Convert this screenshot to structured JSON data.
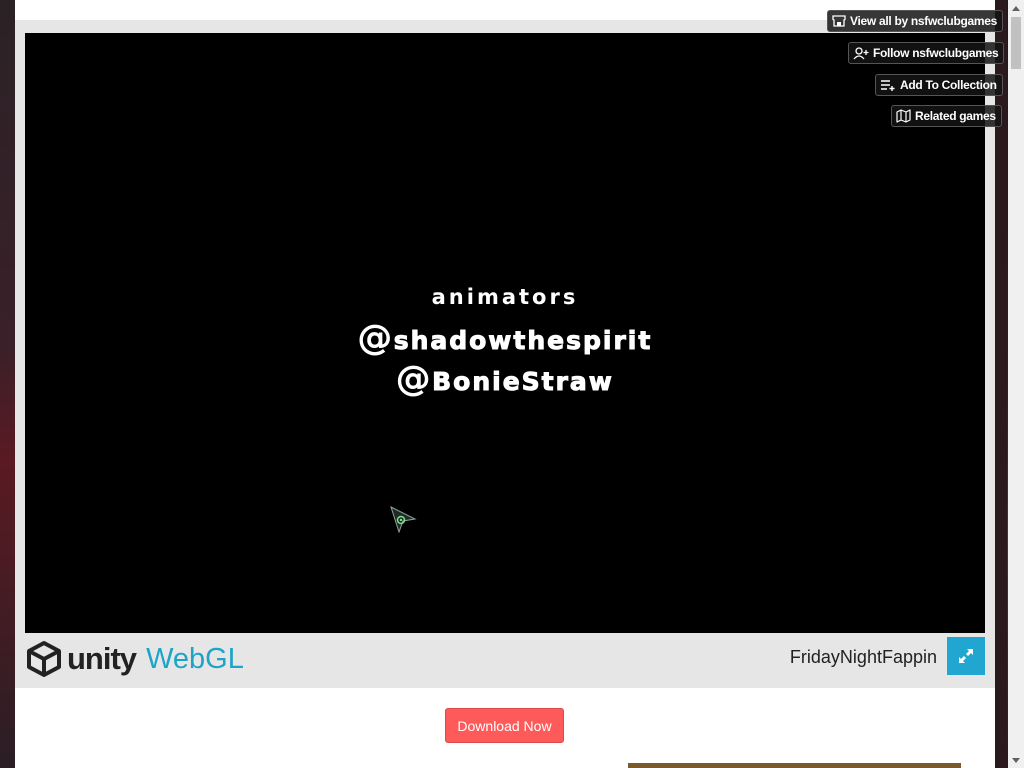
{
  "overlay": {
    "view_all": "View all by nsfwclubgames",
    "follow": "Follow nsfwclubgames",
    "add_collection": "Add To Collection",
    "related": "Related games"
  },
  "game": {
    "credits_heading": "animators",
    "credits": [
      "shadowthespirit",
      "BonieStraw"
    ],
    "credit_prefix": "@"
  },
  "unity": {
    "brand": "unity",
    "platform": "WebGL",
    "title": "FridayNightFappin"
  },
  "page": {
    "download_label": "Download Now"
  },
  "colors": {
    "accent": "#21a6d2",
    "download": "#ff5a5a",
    "webgl": "#1ea4c8"
  }
}
